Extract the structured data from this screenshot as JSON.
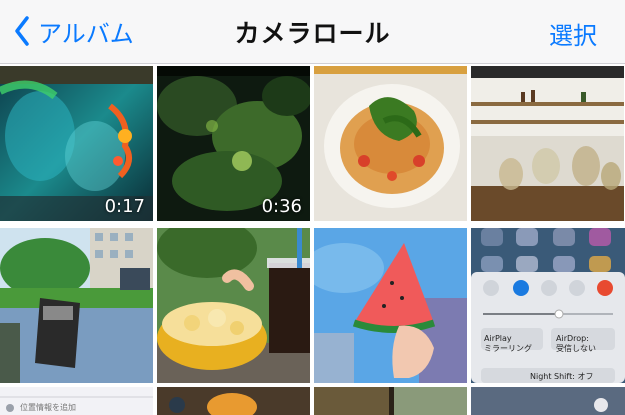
{
  "navbar": {
    "back_label": "アルバム",
    "title": "カメラロール",
    "select_label": "選択"
  },
  "photos": [
    {
      "name": "photo-neon-wall",
      "duration": "0:17"
    },
    {
      "name": "photo-jungle",
      "duration": "0:36"
    },
    {
      "name": "photo-pasta",
      "duration": ""
    },
    {
      "name": "photo-cafe",
      "duration": ""
    },
    {
      "name": "photo-street",
      "duration": ""
    },
    {
      "name": "photo-chips-drink",
      "duration": ""
    },
    {
      "name": "photo-watermelon",
      "duration": ""
    },
    {
      "name": "photo-control-center",
      "duration": ""
    }
  ],
  "control_center": {
    "airplay_label": "AirPlay\nミラーリング",
    "airdrop_label": "AirDrop:\n受信しない",
    "night_shift_label": "Night Shift: オフ"
  },
  "settings_thumb": {
    "row_label": "位置情報を追加"
  },
  "colors": {
    "accent": "#0a7aff",
    "navbar_bg": "#f7f7f8"
  }
}
